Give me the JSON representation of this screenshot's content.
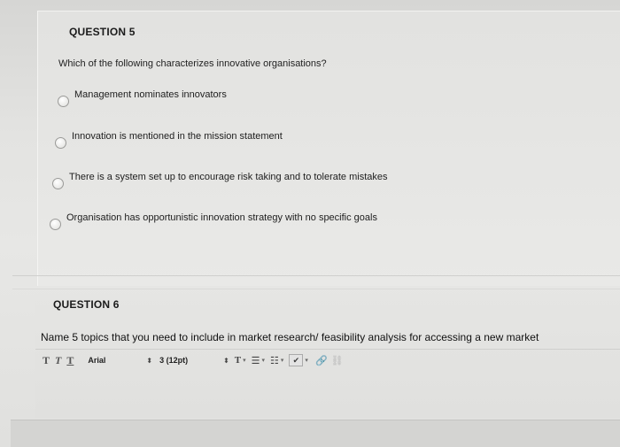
{
  "question5": {
    "title": "QUESTION 5",
    "prompt": "Which of the following characterizes innovative organisations?",
    "options": [
      {
        "label": "Management nominates innovators"
      },
      {
        "label": "Innovation is mentioned in the mission statement"
      },
      {
        "label": "There is a system set up to encourage risk taking and to tolerate mistakes"
      },
      {
        "label": "Organisation has opportunistic innovation strategy with no specific goals"
      }
    ]
  },
  "question6": {
    "title": "QUESTION 6",
    "prompt": "Name 5 topics that you need to include in market research/ feasibility analysis for accessing a new market"
  },
  "toolbar": {
    "bold_t": "T",
    "italic_t": "T",
    "underline_t": "T",
    "font": "Arial",
    "size": "3 (12pt)",
    "stepper": "⬍",
    "text_color": "T",
    "list_unordered": "☰",
    "list_ordered": "☷",
    "dropdown": "▾",
    "spellcheck": "✔",
    "link": "🔗",
    "unlink": "⛓"
  }
}
